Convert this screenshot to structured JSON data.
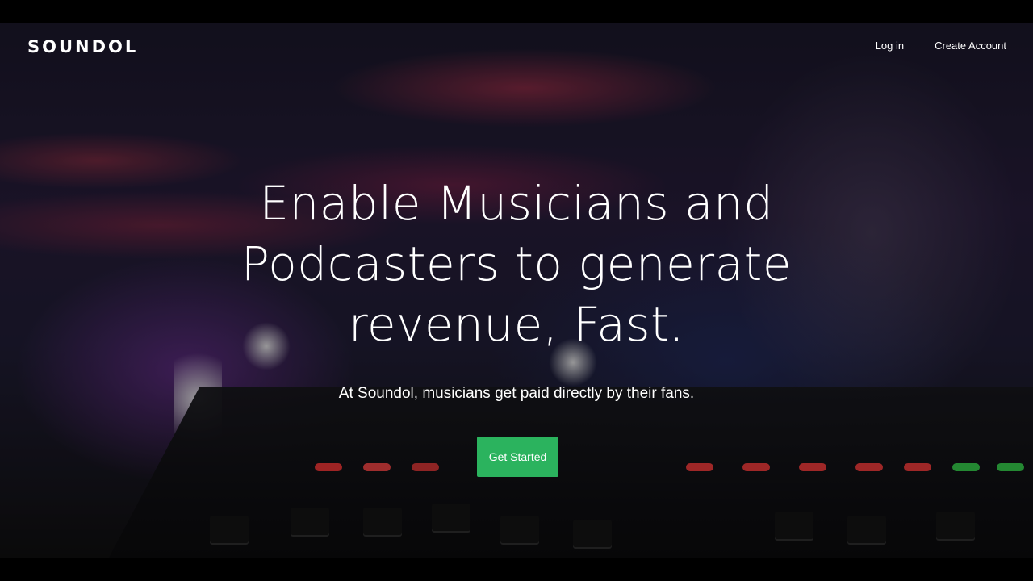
{
  "brand": {
    "logo_text": "SOUNDOL"
  },
  "nav": {
    "login_label": "Log in",
    "create_account_label": "Create Account"
  },
  "hero": {
    "headline_line1": "Enable Musicians and",
    "headline_line2": "Podcasters to generate",
    "headline_line3": "revenue, Fast.",
    "subheadline": "At Soundol, musicians get paid directly by their fans.",
    "cta_label": "Get Started"
  },
  "colors": {
    "cta_green": "#2bb35e",
    "text": "#ffffff",
    "letterbox": "#000000"
  }
}
